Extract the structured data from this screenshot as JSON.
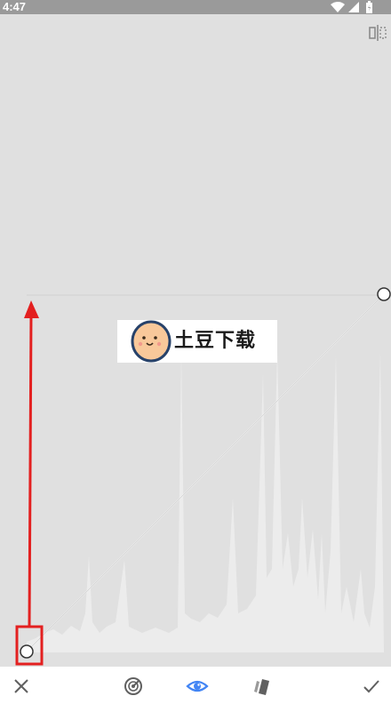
{
  "status_bar": {
    "time": "4:47",
    "icons": [
      "wifi-icon",
      "signal-icon",
      "battery-icon"
    ]
  },
  "watermark": {
    "text": "土豆下载"
  },
  "toolbar": {
    "buttons": [
      "close-icon",
      "auto-adjust-icon",
      "preview-eye-icon",
      "channel-icon",
      "check-icon"
    ]
  },
  "colors": {
    "accent": "#4285f4",
    "annotation": "#e32020",
    "toolbar_icon": "#606060"
  }
}
